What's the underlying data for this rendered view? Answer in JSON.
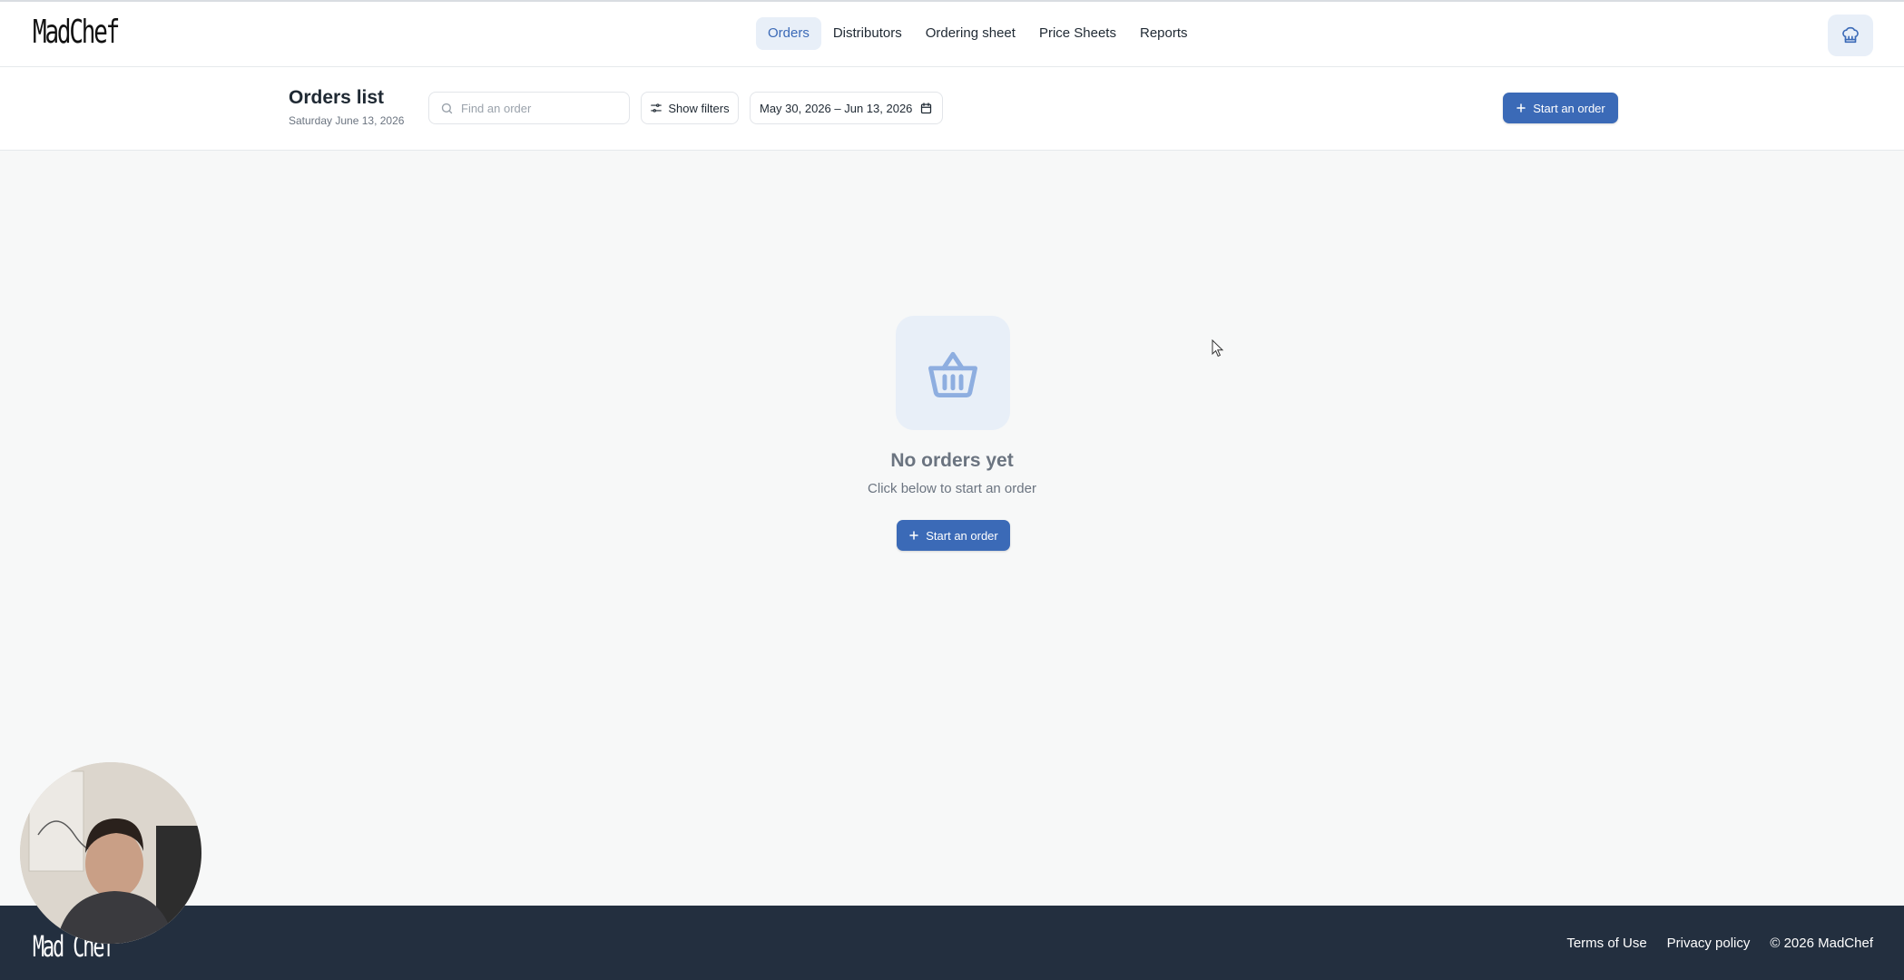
{
  "brand": {
    "logo_text": "MadChef",
    "footer_logo_text": "Mad Chef"
  },
  "nav": {
    "items": [
      {
        "label": "Orders",
        "active": true
      },
      {
        "label": "Distributors",
        "active": false
      },
      {
        "label": "Ordering sheet",
        "active": false
      },
      {
        "label": "Price Sheets",
        "active": false
      },
      {
        "label": "Reports",
        "active": false
      }
    ],
    "profile_icon": "chef-hat-icon"
  },
  "header": {
    "title": "Orders list",
    "date": "Saturday June 13, 2026",
    "search": {
      "placeholder": "Find an order",
      "value": ""
    },
    "filters_label": "Show filters",
    "date_range": "May 30, 2026 – Jun 13, 2026",
    "start_order_label": "Start an order"
  },
  "empty_state": {
    "icon": "basket-icon",
    "title": "No orders yet",
    "subtitle": "Click below to start an order",
    "button_label": "Start an order"
  },
  "footer": {
    "terms": "Terms of Use",
    "privacy": "Privacy policy",
    "copyright": "© 2026 MadChef"
  },
  "colors": {
    "accent": "#3b6ab7",
    "accent_light": "#e8eff8",
    "footer_bg": "#232f3f",
    "page_bg": "#f7f8f8"
  }
}
